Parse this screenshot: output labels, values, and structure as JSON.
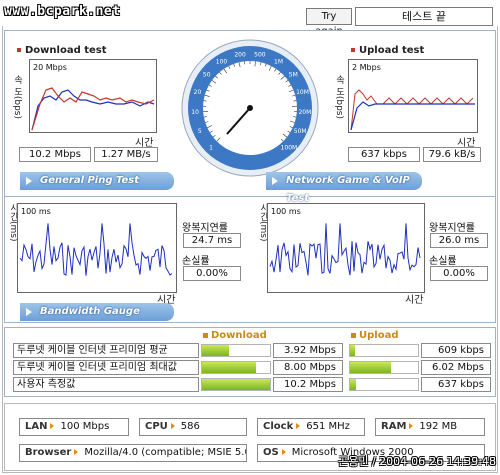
{
  "watermark": "www.bcpark.net",
  "header": {
    "title_fragment": "WAN TEST",
    "try_again_label": "Try again",
    "status_text": "테스트 끝"
  },
  "download": {
    "title": "Download test",
    "y_unit_label": "속 도(bps)",
    "scale_label": "20 Mbps",
    "x_label": "시간",
    "mbps_value": "10.2 Mbps",
    "mbs_value": "1.27 MB/s"
  },
  "upload": {
    "title": "Upload test",
    "y_unit_label": "속 도(bps)",
    "scale_label": "2 Mbps",
    "x_label": "시간",
    "kbps_value": "637 kbps",
    "kbs_value": "79.6 kB/s"
  },
  "gauge": {
    "ticks": [
      "1",
      "5",
      "10",
      "20",
      "50",
      "100",
      "200",
      "500",
      "1M",
      "5M",
      "10M",
      "20M",
      "50M",
      "100M"
    ],
    "needle_value_label": "10.2 Mbps"
  },
  "sections": {
    "ping": "General Ping Test",
    "game": "Network Game & VoIP Test",
    "bandwidth": "Bandwidth Gauge"
  },
  "ping_left": {
    "y_unit": "시간(ms)",
    "scale_label": "100 ms",
    "x_label": "시간",
    "latency_label": "왕복지연률",
    "latency_value": "24.7 ms",
    "loss_label": "손실률",
    "loss_value": "0.00%"
  },
  "ping_right": {
    "y_unit": "시간(ms)",
    "scale_label": "100 ms",
    "x_label": "시간",
    "latency_label": "왕복지연률",
    "latency_value": "26.0 ms",
    "loss_label": "손실률",
    "loss_value": "0.00%"
  },
  "bandwidth": {
    "download_header": "Download",
    "upload_header": "Upload",
    "rows": [
      {
        "label": "두루넷 케이블 인터넷 프리미엄 평균",
        "dl_value": "3.92 Mbps",
        "dl_fill": 0.39,
        "ul_value": "609 kbps",
        "ul_fill": 0.08
      },
      {
        "label": "두루넷 케이블 인터넷 프리미엄 최대값",
        "dl_value": "8.00 Mbps",
        "dl_fill": 0.8,
        "ul_value": "6.02 Mbps",
        "ul_fill": 0.6
      },
      {
        "label": "사용자 측정값",
        "dl_value": "10.2 Mbps",
        "dl_fill": 1.0,
        "ul_value": "637 kbps",
        "ul_fill": 0.09
      }
    ]
  },
  "system": {
    "lan_key": "LAN",
    "lan_value": "100 Mbps",
    "cpu_key": "CPU",
    "cpu_value": "586",
    "clock_key": "Clock",
    "clock_value": "651 MHz",
    "ram_key": "RAM",
    "ram_value": "192 MB",
    "browser_key": "Browser",
    "browser_value": "Mozilla/4.0 (compatible; MSIE 5.0",
    "os_key": "OS",
    "os_value": "Microsoft Windows 2000"
  },
  "stamp": "곤용민 / 2004-06-26 14:39:48",
  "colors": {
    "download_line": "#c0392b",
    "upload_line_blue": "#1f2fbf",
    "ribbon": "#6c9fd6",
    "bar": "#7bb51e"
  }
}
